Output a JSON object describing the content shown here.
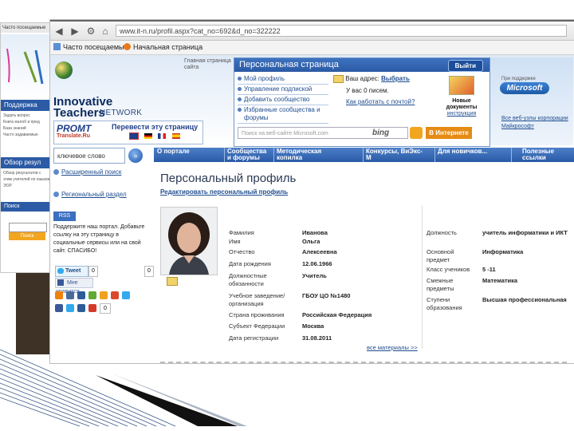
{
  "background_window": {
    "support_title": "Поддержка",
    "support_items": [
      "Задать вопрос",
      "Книга жалоб и пред",
      "База знаний",
      "Часто задаваемые"
    ],
    "review_title": "Обзор резул",
    "review_text": "Обзор результатов с этим учителей по языков ЭОР",
    "search_title": "Поиск",
    "search_button": "Поиск",
    "tab_label": "Часто посещаемые"
  },
  "browser": {
    "url": "www.it-n.ru/profil.aspx?cat_no=692&d_no=322222",
    "favorites": [
      "Часто посещаемые",
      "Начальная страница"
    ]
  },
  "header": {
    "brand_line1": "Innovative",
    "brand_line2": "Teachers",
    "brand_network": "NETWORK",
    "home_link": "Главная страница сайта",
    "promt_logo": "PROMT",
    "promt_sub": "Translate.Ru",
    "promt_translate": "Перевести эту страницу"
  },
  "personal": {
    "title": "Персональная страница",
    "exit_button": "Выйти",
    "menu": [
      "Мой профиль",
      "Управление подпиской",
      "Добавить сообщество",
      "Избранные сообщества и форумы"
    ],
    "mail_label": "Ваш адрес:",
    "mail_value": "Выбрать",
    "mail_count": "У вас 0 писем.",
    "mail_help": "Как работать с почтой?",
    "newdocs_line1": "Новые",
    "newdocs_line2": "документы",
    "newdocs_link": "инструкция",
    "search_placeholder": "Поиск на веб-сайте Microsoft.com",
    "bing": "bing",
    "internet_button": "В Интернете"
  },
  "microsoft": {
    "small_label": "При поддержке",
    "logo": "Microsoft",
    "links": "Все веб-узлы корпорации Майкрософт"
  },
  "left_column": {
    "keyword_value": "ключевое слово",
    "extended_search": "Расширенный поиск",
    "regional_section": "Региональный раздел",
    "rss": "RSS",
    "support_text": "Поддержите наш портал. Добавьте ссылку на эту страницу в социальные сервисы или на свой сайт. СПАСИБО!",
    "tweet": "Tweet",
    "tweet_count": "0",
    "like": "Мне нравится",
    "counter_1": "0",
    "counter_2": "0"
  },
  "nav_tabs": [
    "О портале",
    "Сообщества и форумы",
    "Методическая копилка",
    "Конкурсы, ВиЭкс-М",
    "Для новичков...",
    "Полезные ссылки"
  ],
  "profile": {
    "title": "Персональный профиль",
    "edit_link": "Редактировать персональный профиль",
    "fields_left": [
      {
        "label": "Фамилия",
        "value": "Иванова"
      },
      {
        "label": "Имя",
        "value": "Ольга"
      },
      {
        "label": "Отчество",
        "value": "Алексеевна"
      },
      {
        "label": "Дата рождения",
        "value": "12.06.1966"
      },
      {
        "label": "Должностные обязанности",
        "value": "Учитель"
      },
      {
        "label": "Учебное заведение/организация",
        "value": "ГБОУ ЦО №1480"
      },
      {
        "label": "Страна проживания",
        "value": "Российская Федерация"
      },
      {
        "label": "Субъект Федерации",
        "value": "Москва"
      },
      {
        "label": "Дата регистрации",
        "value": "31.08.2011"
      }
    ],
    "fields_right": [
      {
        "label": "Должность",
        "value": "учитель информатики и ИКТ"
      },
      {
        "label": "Основной предмет",
        "value": "Информатика"
      },
      {
        "label": "Класс учеников",
        "value": "5 -11"
      },
      {
        "label": "Смежные предметы",
        "value": "Математика"
      },
      {
        "label": "Ступени образования",
        "value": "Высшая профессиональная"
      }
    ],
    "more_link": "все материалы >>"
  },
  "colors": {
    "primary_blue": "#2b5aa6",
    "link_blue": "#1f4d8f",
    "orange": "#e58b14",
    "dark_triangle": "#111111"
  }
}
